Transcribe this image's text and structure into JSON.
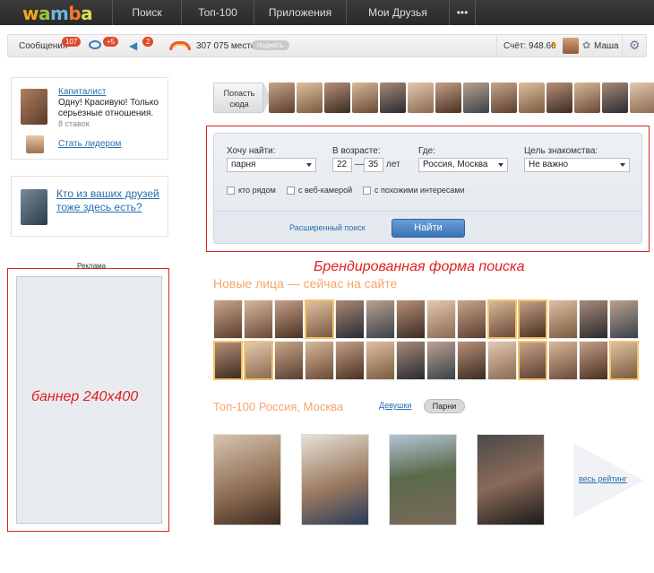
{
  "nav": {
    "logo": [
      "w",
      "a",
      "m",
      "b",
      "a"
    ],
    "items": [
      "Поиск",
      "Топ-100",
      "Приложения",
      "Мои Друзья",
      "•••"
    ]
  },
  "subbar": {
    "messages": "Сообщения",
    "messages_count": "107",
    "views_count": "+5",
    "notify_count": "2",
    "rank": "307 075 место",
    "raise": "поднять",
    "balance": "Счёт: 948.66",
    "username": "Маша"
  },
  "user_card": {
    "name": "Капиталист",
    "quote": "Одну! Красивую! Только серьезные отношения.",
    "bets": "8 ставок",
    "leader_link": "Стать лидером"
  },
  "friends_card": {
    "text": "Кто из ваших друзей тоже здесь есть?"
  },
  "ad": {
    "label": "Реклама",
    "banner": "баннер 240x400"
  },
  "strip": {
    "label": "Попасть сюда"
  },
  "search_form": {
    "want_label": "Хочу найти:",
    "want_value": "парня",
    "age_label": "В возрасте:",
    "age_from": "22",
    "age_dash": "—",
    "age_to": "35",
    "age_unit": "лет",
    "where_label": "Где:",
    "where_value": "Россия, Москва",
    "goal_label": "Цель знакомства:",
    "goal_value": "Не важно",
    "chk_near": "кто рядом",
    "chk_cam": "с веб-камерой",
    "chk_interests": "с похожими интересами",
    "advanced": "Расширенный поиск",
    "submit": "Найти"
  },
  "annotation": "Брендированная форма поиска",
  "new_faces": {
    "title": "Новые лица — сейчас на сайте"
  },
  "top100": {
    "title": "Топ-100 Россия, Москва",
    "tab_girls": "Девушки",
    "tab_boys": "Парни",
    "all_rating": "весь рейтинг"
  },
  "colors": {
    "accent_orange": "#f7a46a",
    "link_blue": "#2a6db0",
    "annotation_red": "#e02020"
  }
}
